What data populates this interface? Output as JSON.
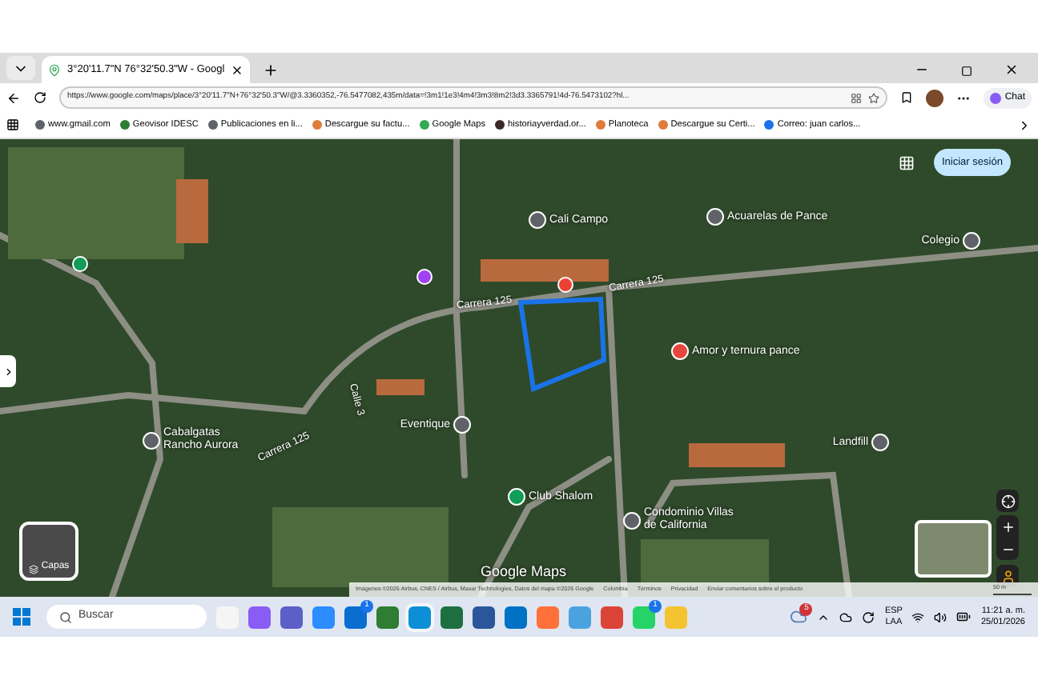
{
  "browser": {
    "tab_title": "3°20'11.7\"N 76°32'50.3\"W - Googl",
    "url": "https://www.google.com/maps/place/3°20'11.7\"N+76°32'50.3\"W/@3.3360352,-76.5477082,435m/data=!3m1!1e3!4m4!3m3!8m2!3d3.3365791!4d-76.5473102?hl...",
    "chat": "Chat",
    "bookmarks": [
      {
        "label": "www.gmail.com",
        "color": "#5f6368"
      },
      {
        "label": "Geovisor IDESC",
        "color": "#2e7d32"
      },
      {
        "label": "Publicaciones en li...",
        "color": "#5f6368"
      },
      {
        "label": "Descargue su factu...",
        "color": "#e07b39"
      },
      {
        "label": "Google Maps",
        "color": "#34a853"
      },
      {
        "label": "historiayverdad.or...",
        "color": "#3c2a2a"
      },
      {
        "label": "Planoteca",
        "color": "#e07b39"
      },
      {
        "label": "Descargue su Certi...",
        "color": "#e07b39"
      },
      {
        "label": "Correo: juan carlos...",
        "color": "#1a73e8"
      }
    ]
  },
  "map": {
    "sign_in": "Iniciar sesión",
    "layers": "Capas",
    "places": [
      {
        "name": "Cali Campo",
        "color": "#5f6368"
      },
      {
        "name": "Acuarelas de Pance",
        "color": "#5f6368"
      },
      {
        "name": "Colegio",
        "color": "#5f6368"
      },
      {
        "name": "Amor y ternura pance",
        "color": "#e8453c"
      },
      {
        "name": "Cabalgatas\nRancho Aurora",
        "color": "#5f6368"
      },
      {
        "name": "Eventique",
        "color": "#5f6368"
      },
      {
        "name": "Landfill",
        "color": "#5f6368"
      },
      {
        "name": "Club Shalom",
        "color": "#0f9d58"
      },
      {
        "name": "Condominio Villas\nde California",
        "color": "#5f6368"
      }
    ],
    "road_labels": [
      "Carrera 125",
      "Carrera 125",
      "Carrera 125",
      "Calle 3"
    ],
    "logo": "Google Maps",
    "attribution": [
      "Imágenes ©2026 Airbus, CNES / Airbus, Maxar Technologies, Datos del mapa ©2026 Google",
      "Colombia",
      "Términos",
      "Privacidad",
      "Enviar comentarios sobre el producto"
    ],
    "scale": "50 m"
  },
  "taskbar": {
    "search": "Buscar",
    "apps": [
      {
        "color": "#f5f5f5"
      },
      {
        "color": "#8a5cf6"
      },
      {
        "color": "#5b5fc7"
      },
      {
        "color": "#2d8cff"
      },
      {
        "color": "#0a6ed1",
        "badge": "1"
      },
      {
        "color": "#2e7d32"
      },
      {
        "color": "#0c8fd6",
        "selected": true
      },
      {
        "color": "#1d6f42"
      },
      {
        "color": "#2b579a"
      },
      {
        "color": "#0072c6"
      },
      {
        "color": "#ff7139"
      },
      {
        "color": "#4aa3df"
      },
      {
        "color": "#db4437"
      },
      {
        "color": "#25d366",
        "badge": "1"
      },
      {
        "color": "#f4c430"
      }
    ],
    "weather_badge": "5",
    "lang": "ESP",
    "layout": "LAA",
    "time": "11:21 a. m.",
    "date": "25/01/2026"
  }
}
